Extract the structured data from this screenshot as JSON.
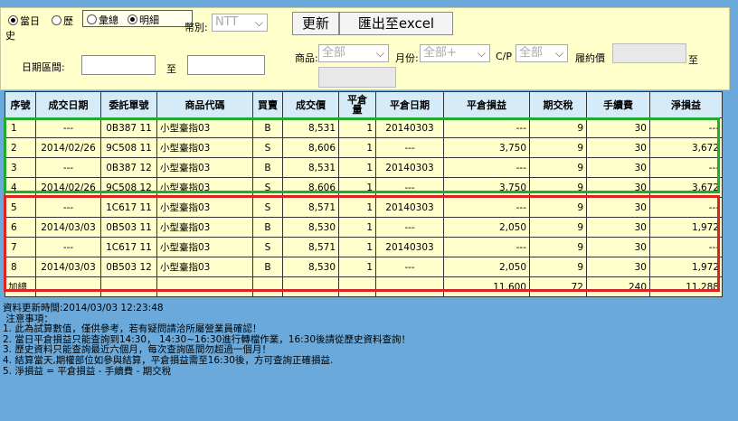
{
  "filter": {
    "radio_today": "當日",
    "radio_history": "歷",
    "radio_history_wrap": "史",
    "radio_summary": "彙總",
    "radio_detail": "明細",
    "currency_label": "幣別:",
    "currency_value": "NTT",
    "refresh_label": "更新",
    "export_label": "匯出至excel",
    "date_range_label": "日期區間:",
    "to_label": "至",
    "product_label": "商品:",
    "product_value": "全部",
    "month_label": "月份:",
    "month_value": "全部+",
    "cp_label": "C/P",
    "cp_value": "全部",
    "strike_label": "履約價",
    "strike_to_label": "至"
  },
  "table": {
    "headers": [
      "序號",
      "成交日期",
      "委託單號",
      "商品代碼",
      "買賣",
      "成交價",
      "平倉量",
      "平倉日期",
      "平倉損益",
      "期交稅",
      "手續費",
      "淨損益"
    ],
    "rows": [
      [
        "1",
        "---",
        "0B387 11",
        "小型臺指03",
        "B",
        "8,531",
        "1",
        "20140303",
        "---",
        "9",
        "30",
        "---"
      ],
      [
        "2",
        "2014/02/26",
        "9C508 11",
        "小型臺指03",
        "S",
        "8,606",
        "1",
        "---",
        "3,750",
        "9",
        "30",
        "3,672"
      ],
      [
        "3",
        "---",
        "0B387 12",
        "小型臺指03",
        "B",
        "8,531",
        "1",
        "20140303",
        "---",
        "9",
        "30",
        "---"
      ],
      [
        "4",
        "2014/02/26",
        "9C508 12",
        "小型臺指03",
        "S",
        "8,606",
        "1",
        "---",
        "3,750",
        "9",
        "30",
        "3,672"
      ],
      [
        "5",
        "---",
        "1C617 11",
        "小型臺指03",
        "S",
        "8,571",
        "1",
        "20140303",
        "---",
        "9",
        "30",
        "---"
      ],
      [
        "6",
        "2014/03/03",
        "0B503 11",
        "小型臺指03",
        "B",
        "8,530",
        "1",
        "---",
        "2,050",
        "9",
        "30",
        "1,972"
      ],
      [
        "7",
        "---",
        "1C617 11",
        "小型臺指03",
        "S",
        "8,571",
        "1",
        "20140303",
        "---",
        "9",
        "30",
        "---"
      ],
      [
        "8",
        "2014/03/03",
        "0B503 12",
        "小型臺指03",
        "B",
        "8,530",
        "1",
        "---",
        "2,050",
        "9",
        "30",
        "1,972"
      ]
    ],
    "total_label": "加總",
    "total": {
      "pnl": "11,600",
      "tax": "72",
      "fee": "240",
      "net": "11,288"
    }
  },
  "notes": {
    "updated": "資料更新時間:2014/03/03 12:23:48",
    "title": " 注意事項：",
    "lines": [
      "1. 此為試算數值，僅供參考，若有疑問請洽所屬營業員確認！",
      "2. 當日平倉損益只能查詢到14:30， 14:30~16:30進行轉檔作業，16:30後請從歷史資料查詢！",
      "3. 歷史資料只能查詢最近六個月，每次查詢區間勿超過一個月！",
      "4. 結算當天,期權部位如參與結算，平倉損益需至16:30後，方可查詢正確損益.",
      "5. 淨損益 = 平倉損益 - 手續費 - 期交稅"
    ]
  }
}
